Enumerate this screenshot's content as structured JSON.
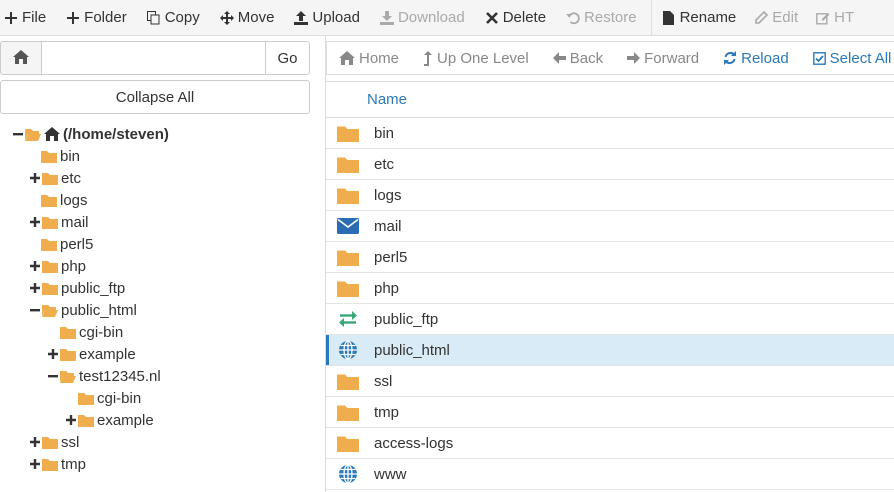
{
  "toolbar": {
    "file": "File",
    "folder": "Folder",
    "copy": "Copy",
    "move": "Move",
    "upload": "Upload",
    "download": "Download",
    "delete": "Delete",
    "restore": "Restore",
    "rename": "Rename",
    "edit": "Edit",
    "html_edit": "HT"
  },
  "address": {
    "value": "",
    "go": "Go"
  },
  "collapse_all": "Collapse All",
  "tree": {
    "root": "(/home/steven)",
    "bin": "bin",
    "etc": "etc",
    "logs": "logs",
    "mail": "mail",
    "perl5": "perl5",
    "php": "php",
    "public_ftp": "public_ftp",
    "public_html": "public_html",
    "cgi_bin": "cgi-bin",
    "example": "example",
    "test12345": "test12345.nl",
    "t_cgi_bin": "cgi-bin",
    "t_example": "example",
    "ssl": "ssl",
    "tmp": "tmp"
  },
  "nav": {
    "home": "Home",
    "up": "Up One Level",
    "back": "Back",
    "forward": "Forward",
    "reload": "Reload",
    "select_all": "Select All"
  },
  "list": {
    "header_name": "Name",
    "rows": [
      {
        "name": "bin",
        "icon": "folder-icon"
      },
      {
        "name": "etc",
        "icon": "folder-icon"
      },
      {
        "name": "logs",
        "icon": "folder-icon"
      },
      {
        "name": "mail",
        "icon": "mail-icon"
      },
      {
        "name": "perl5",
        "icon": "folder-icon"
      },
      {
        "name": "php",
        "icon": "folder-icon"
      },
      {
        "name": "public_ftp",
        "icon": "transfer-icon"
      },
      {
        "name": "public_html",
        "icon": "globe-icon",
        "selected": true
      },
      {
        "name": "ssl",
        "icon": "folder-icon"
      },
      {
        "name": "tmp",
        "icon": "folder-icon"
      },
      {
        "name": "access-logs",
        "icon": "folder-icon"
      },
      {
        "name": "www",
        "icon": "globe-icon"
      }
    ]
  },
  "colors": {
    "folder": "#f0ad4e",
    "link": "#2a7ab9",
    "selected_row": "#d9ebf7",
    "transfer": "#3aa876"
  }
}
